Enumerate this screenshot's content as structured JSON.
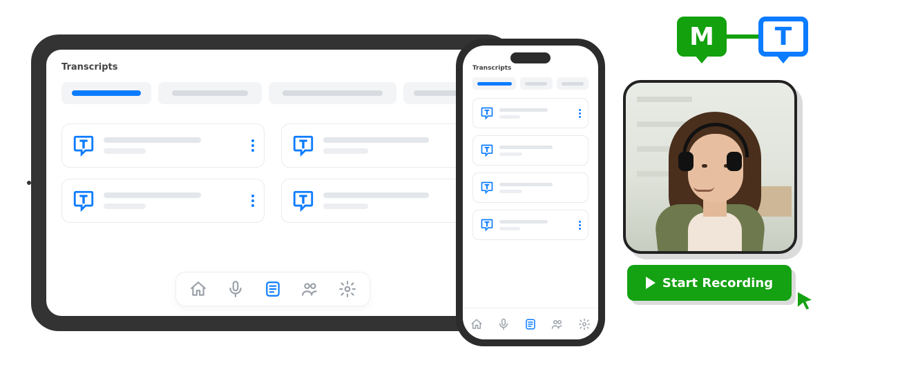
{
  "tablet": {
    "title": "Transcripts",
    "nav": {
      "home": "home",
      "mic": "record",
      "transcripts": "transcripts",
      "people": "contacts",
      "settings": "settings"
    }
  },
  "phone": {
    "title": "Transcripts"
  },
  "badges": {
    "left": "M",
    "right": "T"
  },
  "recording": {
    "button_label": "Start Recording"
  }
}
